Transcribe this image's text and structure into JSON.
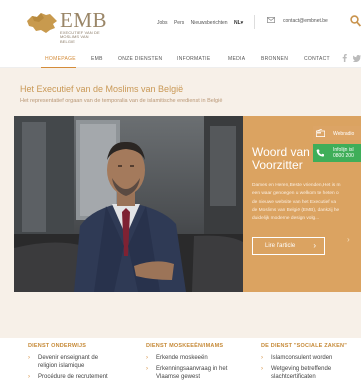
{
  "header": {
    "logo": {
      "name": "EMB",
      "subtitle": "EXECUTIEF VAN DE MOSLIMS VAN BELGIE"
    },
    "top_links": [
      "Jobs",
      "Pers",
      "Nieuwsberichten"
    ],
    "language": "NL▾",
    "email": "contact@embnet.be"
  },
  "nav": {
    "items": [
      "HOMEPAGE",
      "EMB",
      "ONZE DIENSTEN",
      "INFORMATIE",
      "MEDIA",
      "BRONNEN",
      "CONTACT"
    ],
    "active": "HOMEPAGE"
  },
  "hero": {
    "title": "Het Executief van de Moslims van België",
    "subtitle": "Het representatief orgaan van de temporalia van de islamitische eredienst in België"
  },
  "panel": {
    "title_line1": "Woord van",
    "title_line2": "Voorzitter",
    "text_lines": [
      "Dames en Heren,Beste vrienden,Het is m",
      "een waar genoegen u welkom te heten o",
      "de nieuwe website van het Executief va",
      "de Moslims van België (EMB), dankzij he",
      "duidelijk moderne design volg..."
    ],
    "button": "Lire l'article",
    "button_arrow": "›",
    "next_arrow": "›"
  },
  "widgets": {
    "webradio": "Webradio",
    "info_line1": "Infolijn isl",
    "info_line2": "0800 200"
  },
  "services": [
    {
      "title": "DIENST ONDERWIJS",
      "items": [
        [
          "Devenir enseignant de",
          "religion islamique"
        ],
        [
          "Procédure de recrutement"
        ]
      ]
    },
    {
      "title": "DIENST MOSKEEËN/IMAMS",
      "items": [
        [
          "Erkende moskeeën"
        ],
        [
          "Erkenningsaanvraag in het",
          "Vlaamse gewest"
        ]
      ]
    },
    {
      "title": "DE DIENST \"SOCIALE ZAKEN\"",
      "items": [
        [
          "Islamconsulent worden"
        ],
        [
          "Wetgeving betreffende",
          "slachtcertificaten"
        ]
      ]
    }
  ],
  "colors": {
    "accent": "#d48c3a",
    "panel": "#dba361",
    "hero_bg": "#f7f0e8",
    "info_green": "#3fae59"
  },
  "icons": [
    "logo-map-icon",
    "mail-icon",
    "search-icon",
    "facebook-icon",
    "twitter-icon",
    "radio-icon",
    "phone-icon",
    "chevron-right-icon"
  ]
}
